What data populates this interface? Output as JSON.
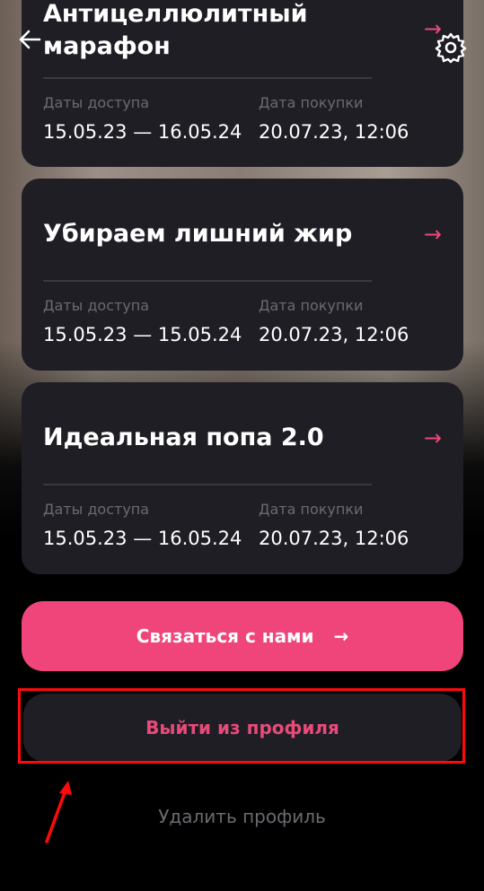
{
  "header": {
    "back_icon": "arrow-left-icon",
    "settings_icon": "gear-icon"
  },
  "cards": [
    {
      "title_line1": "Антицеллюлитный",
      "title_line2": "марафон",
      "access_label": "Даты доступа",
      "access_value": "15.05.23 — 16.05.24",
      "purchase_label": "Дата покупки",
      "purchase_value": "20.07.23, 12:06"
    },
    {
      "title": "Убираем лишний жир",
      "arrow": "→",
      "access_label": "Даты доступа",
      "access_value": "15.05.23 — 15.05.24",
      "purchase_label": "Дата покупки",
      "purchase_value": "20.07.23, 12:06"
    },
    {
      "title": "Идеальная попа 2.0",
      "arrow": "→",
      "access_label": "Даты доступа",
      "access_value": "15.05.23 — 16.05.24",
      "purchase_label": "Дата покупки",
      "purchase_value": "20.07.23, 12:06"
    }
  ],
  "buttons": {
    "contact_label": "Связаться с нами",
    "contact_arrow": "→",
    "logout_label": "Выйти из профиля",
    "delete_label": "Удалить профиль"
  },
  "colors": {
    "accent": "#f0457b",
    "card_bg": "#1f1e24",
    "annotation": "#ff0a0a"
  }
}
